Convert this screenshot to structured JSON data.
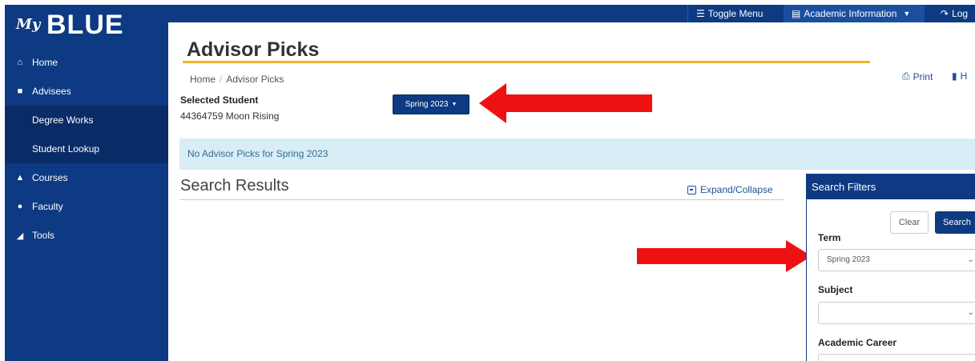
{
  "app": {
    "logo_prefix": "My",
    "logo_name": "BLUE"
  },
  "topbar": {
    "toggle_menu": "Toggle Menu",
    "academic_information": "Academic Information",
    "logout": "Log"
  },
  "sidebar": {
    "items": [
      {
        "label": "Home",
        "icon": "home-icon"
      },
      {
        "label": "Advisees",
        "icon": "folder-icon"
      },
      {
        "label": "Degree Works",
        "icon": ""
      },
      {
        "label": "Student Lookup",
        "icon": ""
      },
      {
        "label": "Courses",
        "icon": "graduation-cap-icon"
      },
      {
        "label": "Faculty",
        "icon": "user-icon"
      },
      {
        "label": "Tools",
        "icon": "chart-icon"
      }
    ]
  },
  "page": {
    "title": "Advisor Picks",
    "breadcrumb": [
      "Home",
      "Advisor Picks"
    ],
    "print": "Print",
    "help": "H",
    "selected_student_label": "Selected Student",
    "selected_student_value": "44364759 Moon  Rising",
    "term_button": "Spring 2023",
    "alert": "No Advisor Picks for Spring 2023",
    "results_title": "Search Results",
    "expand_collapse": "Expand/Collapse"
  },
  "filters": {
    "title": "Search Filters",
    "clear": "Clear",
    "search": "Search",
    "term_label": "Term",
    "term_value": "Spring 2023",
    "subject_label": "Subject",
    "subject_value": "",
    "career_label": "Academic Career",
    "career_value": ""
  },
  "colors": {
    "brand_blue": "#0d3a82",
    "accent_gold": "#f0b429",
    "alert_bg": "#d9edf7",
    "arrow_red": "#ee1111"
  }
}
